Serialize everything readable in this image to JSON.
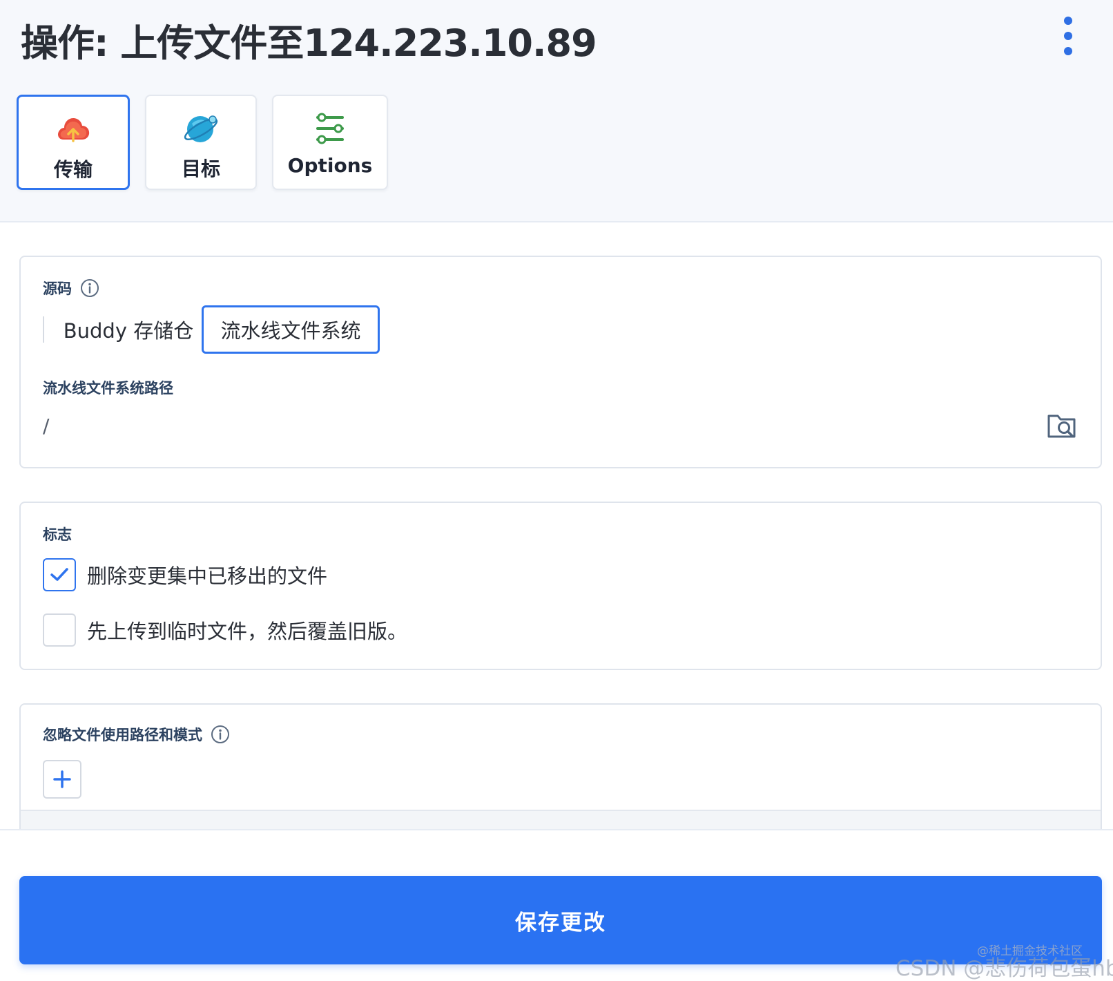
{
  "header": {
    "title": "操作: 上传文件至124.223.10.89",
    "more_icon": "kebab-menu-icon"
  },
  "tabs": [
    {
      "label": "传输",
      "icon": "cloud-upload-icon",
      "active": true
    },
    {
      "label": "目标",
      "icon": "planet-icon",
      "active": false
    },
    {
      "label": "Options",
      "icon": "sliders-icon",
      "active": false
    }
  ],
  "source": {
    "label": "源码",
    "options": [
      "Buddy 存储仓",
      "流水线文件系统"
    ],
    "selected": "流水线文件系统",
    "path_label": "流水线文件系统路径",
    "path_value": "/",
    "browse_icon": "folder-search-icon"
  },
  "flags": {
    "label": "标志",
    "items": [
      {
        "text": "删除变更集中已移出的文件",
        "checked": true
      },
      {
        "text": "先上传到临时文件，然后覆盖旧版。",
        "checked": false
      }
    ]
  },
  "ignore": {
    "label": "忽略文件使用路径和模式",
    "add_icon": "plus-icon"
  },
  "footer": {
    "save_label": "保存更改"
  },
  "watermark": {
    "small": "@稀土掘金技术社区",
    "large": "CSDN @悲伤荷包蛋hb"
  },
  "colors": {
    "accent": "#2a72f2",
    "label_text": "#2c4260",
    "header_bg": "#f6f8fc"
  }
}
